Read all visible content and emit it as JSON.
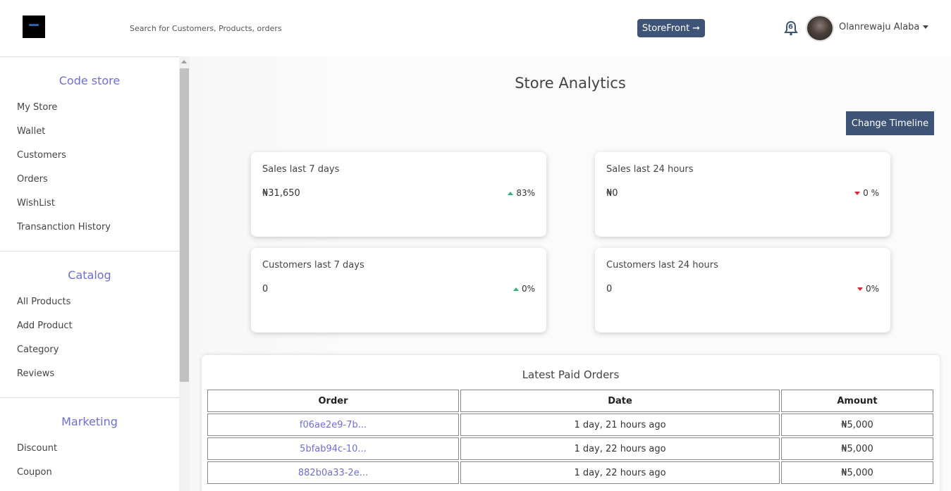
{
  "header": {
    "search_placeholder": "Search for Customers, Products, orders",
    "storefront_label": "StoreFront",
    "storefront_arrow": "➞",
    "notification_count": "6",
    "username": "Olanrewaju Alaba"
  },
  "sidebar": {
    "sections": [
      {
        "title": "Code store",
        "items": [
          "My Store",
          "Wallet",
          "Customers",
          "Orders",
          "WishList",
          "Transanction History"
        ]
      },
      {
        "title": "Catalog",
        "items": [
          "All Products",
          "Add Product",
          "Category",
          "Reviews"
        ]
      },
      {
        "title": "Marketing",
        "items": [
          "Discount",
          "Coupon"
        ]
      }
    ]
  },
  "main": {
    "title": "Store Analytics",
    "change_timeline_label": "Change Timeline",
    "cards": [
      {
        "title": "Sales last 7 days",
        "value": "₦31,650",
        "change": "83%",
        "trend": "up"
      },
      {
        "title": "Sales last 24 hours",
        "value": "₦0",
        "change": "0 %",
        "trend": "down"
      },
      {
        "title": "Customers last 7 days",
        "value": "0",
        "change": "0%",
        "trend": "up"
      },
      {
        "title": "Customers last 24 hours",
        "value": "0",
        "change": "0%",
        "trend": "down"
      }
    ],
    "orders": {
      "title": "Latest Paid Orders",
      "columns": [
        "Order",
        "Date",
        "Amount"
      ],
      "rows": [
        {
          "order": "f06ae2e9-7b...",
          "date": "1 day, 21 hours ago",
          "amount": "₦5,000"
        },
        {
          "order": "5bfab94c-10...",
          "date": "1 day, 22 hours ago",
          "amount": "₦5,000"
        },
        {
          "order": "882b0a33-2e...",
          "date": "1 day, 22 hours ago",
          "amount": "₦5,000"
        }
      ]
    }
  },
  "colors": {
    "accent": "#6e6ed8",
    "button": "#3e5476",
    "up": "#2fb67a",
    "down": "#d3253c"
  }
}
